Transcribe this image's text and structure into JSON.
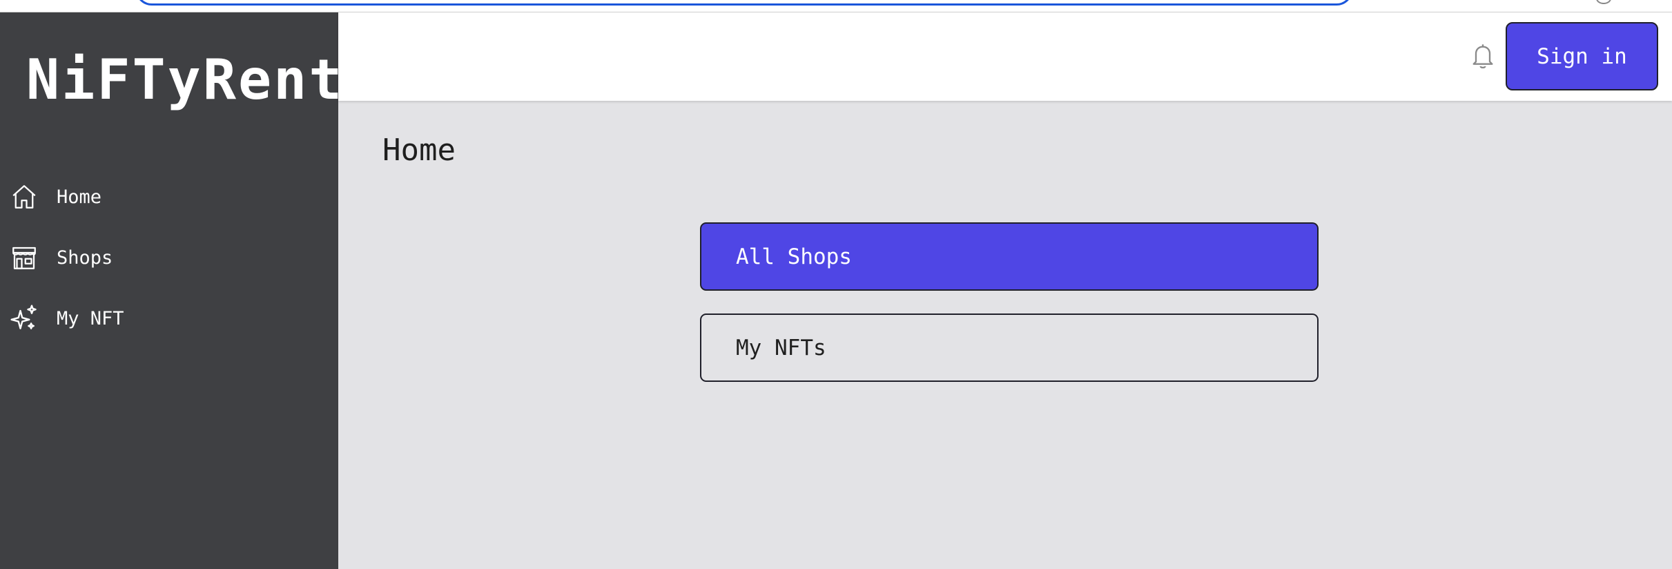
{
  "brand": {
    "name": "NiFTyRent"
  },
  "sidebar": {
    "items": [
      {
        "label": "Home",
        "icon": "home-icon"
      },
      {
        "label": "Shops",
        "icon": "store-icon"
      },
      {
        "label": "My NFT",
        "icon": "sparkles-icon"
      }
    ]
  },
  "header": {
    "notifications_icon": "bell-icon",
    "signin_label": "Sign in"
  },
  "main": {
    "title": "Home",
    "buttons": [
      {
        "label": "All Shops",
        "style": "primary"
      },
      {
        "label": "My NFTs",
        "style": "outline"
      }
    ]
  },
  "colors": {
    "sidebar_bg": "#3f4043",
    "accent": "#4f46e5",
    "main_bg": "#e3e3e6",
    "header_bg": "#ffffff"
  }
}
